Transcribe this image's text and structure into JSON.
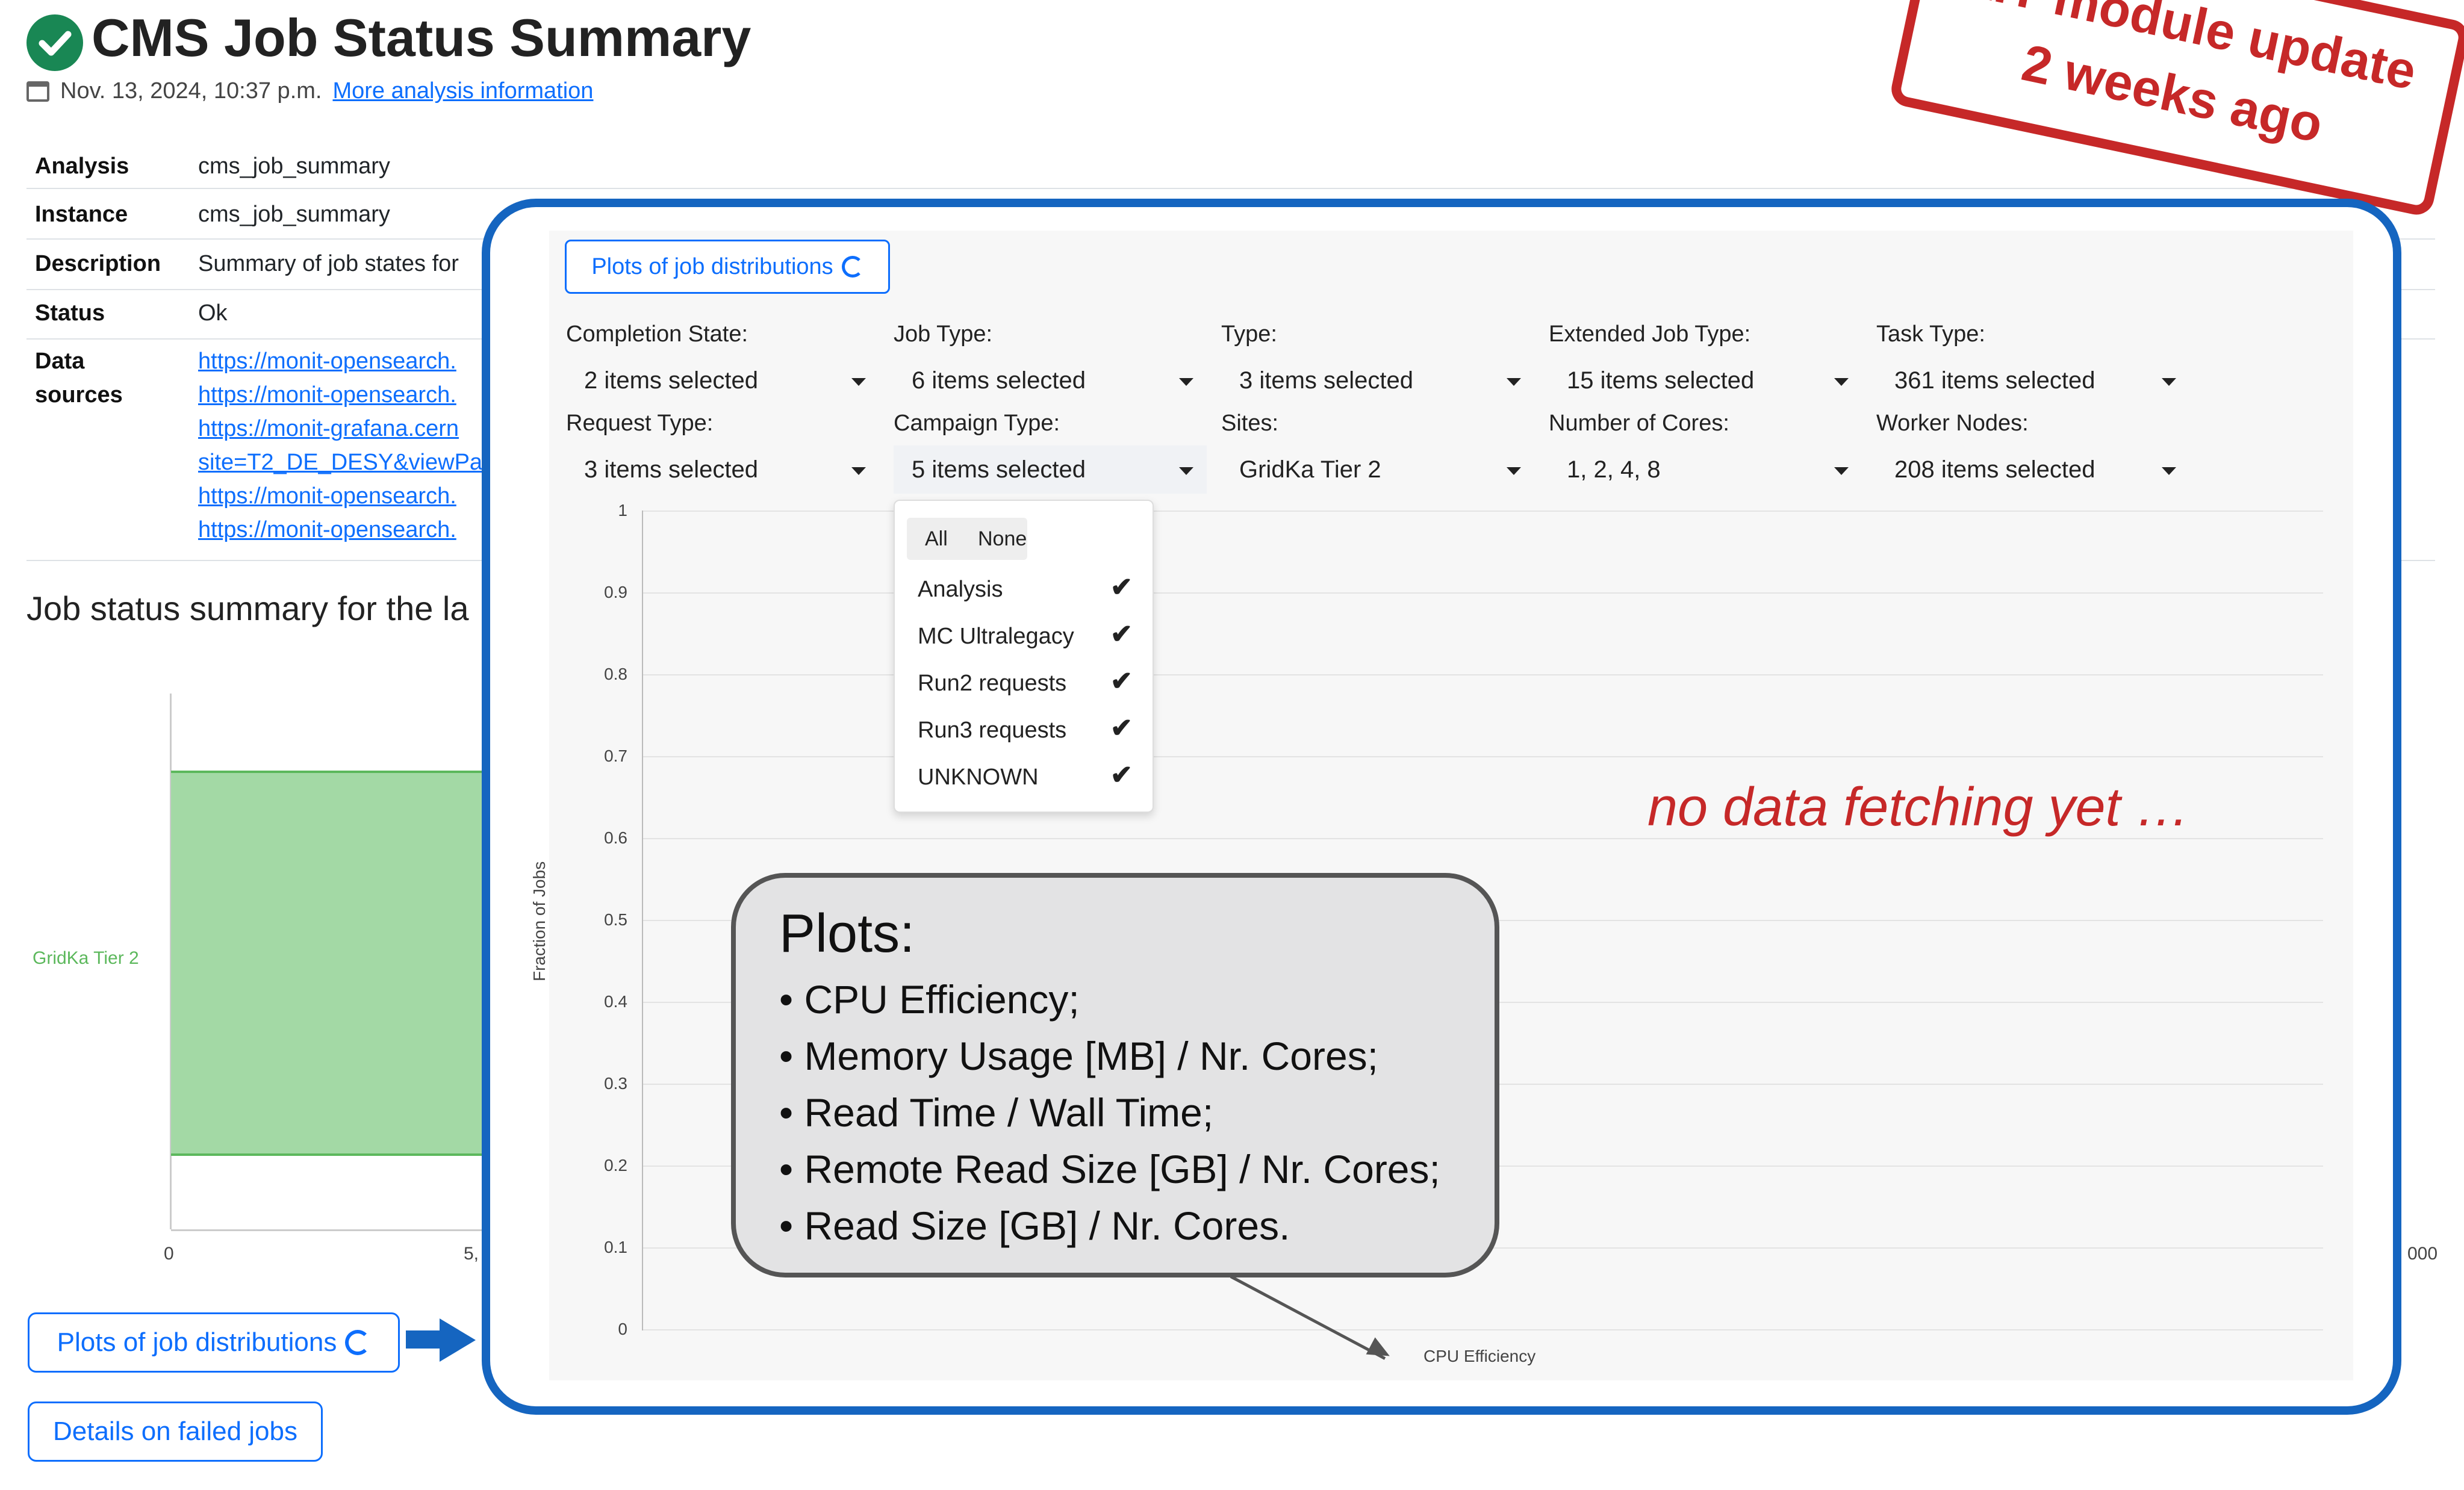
{
  "header": {
    "title": "CMS Job Status Summary",
    "date": "Nov. 13, 2024, 10:37 p.m.",
    "more_link": "More analysis information"
  },
  "info": {
    "analysis_key": "Analysis",
    "analysis_val": "cms_job_summary",
    "instance_key": "Instance",
    "instance_val": "cms_job_summary",
    "description_key": "Description",
    "description_val": "Summary of job states for",
    "status_key": "Status",
    "status_val": "Ok",
    "datasources_key_1": "Data",
    "datasources_key_2": "sources",
    "links": [
      "https://monit-opensearch.",
      "https://monit-opensearch.",
      "https://monit-grafana.cern",
      "site=T2_DE_DESY&viewPa",
      "https://monit-opensearch.",
      "https://monit-opensearch."
    ]
  },
  "summary_heading": "Job status summary for the la",
  "bg_chart": {
    "category": "GridKa Tier 2",
    "tick_0": "0",
    "tick_5": "5,",
    "tick_end": "000"
  },
  "buttons": {
    "plots": "Plots of job distributions",
    "failed": "Details on failed jobs"
  },
  "annotation": {
    "stamp_line1": "KIT module update",
    "stamp_line2": "2 weeks ago",
    "no_data": "no data fetching yet …"
  },
  "popup": {
    "plots_button": "Plots of job distributions",
    "filters": [
      {
        "label": "Completion State:",
        "value": "2 items selected"
      },
      {
        "label": "Job Type:",
        "value": "6 items selected"
      },
      {
        "label": "Type:",
        "value": "3 items selected"
      },
      {
        "label": "Extended Job Type:",
        "value": "15 items selected"
      },
      {
        "label": "Task Type:",
        "value": "361 items selected"
      },
      {
        "label": "Request Type:",
        "value": "3 items selected"
      },
      {
        "label": "Campaign Type:",
        "value": "5 items selected"
      },
      {
        "label": "Sites:",
        "value": "GridKa Tier 2"
      },
      {
        "label": "Number of Cores:",
        "value": "1, 2, 4, 8"
      },
      {
        "label": "Worker Nodes:",
        "value": "208 items selected"
      }
    ],
    "dropdown": {
      "all": "All",
      "none": "None",
      "items": [
        "Analysis",
        "MC Ultralegacy",
        "Run2 requests",
        "Run3 requests",
        "UNKNOWN"
      ]
    },
    "chart": {
      "ylabel": "Fraction of Jobs",
      "xlabel": "CPU Efficiency",
      "yticks": [
        "1",
        "0.9",
        "0.8",
        "0.7",
        "0.6",
        "0.5",
        "0.4",
        "0.3",
        "0.2",
        "0.1",
        "0"
      ]
    }
  },
  "callout": {
    "title": "Plots:",
    "items": [
      "CPU Efficiency;",
      "Memory Usage [MB] / Nr. Cores;",
      "Read Time / Wall Time;",
      "Remote Read Size [GB] / Nr. Cores;",
      "Read Size [GB] / Nr. Cores."
    ]
  }
}
